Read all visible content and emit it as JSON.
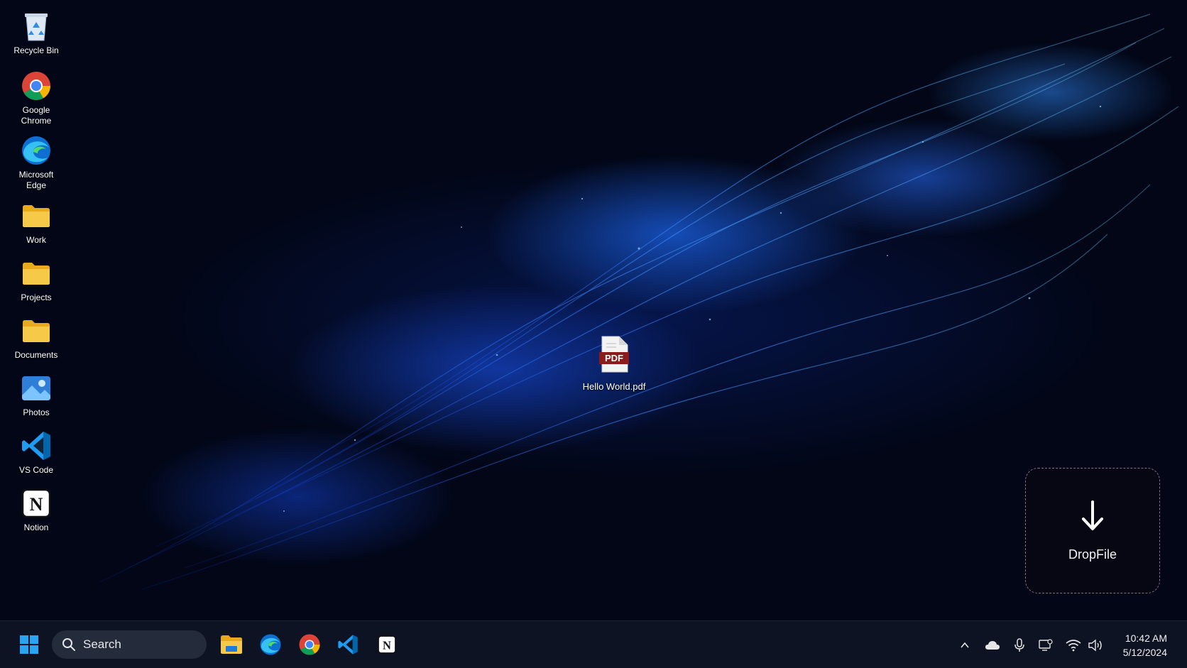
{
  "desktop": {
    "icons": [
      {
        "label": "Recycle Bin",
        "icon": "recycle-bin-icon"
      },
      {
        "label": "Google\nChrome",
        "icon": "chrome-icon"
      },
      {
        "label": "Microsoft\nEdge",
        "icon": "edge-icon"
      },
      {
        "label": "Work",
        "icon": "folder-icon"
      },
      {
        "label": "Projects",
        "icon": "folder-icon"
      },
      {
        "label": "Documents",
        "icon": "folder-icon"
      },
      {
        "label": "Photos",
        "icon": "photos-icon"
      },
      {
        "label": "VS Code",
        "icon": "vscode-icon"
      },
      {
        "label": "Notion",
        "icon": "notion-icon"
      }
    ],
    "file": {
      "label": "Hello World.pdf",
      "badge": "PDF"
    }
  },
  "dropfile": {
    "label": "DropFile"
  },
  "taskbar": {
    "search_placeholder": "Search",
    "pinned": [
      "file-explorer-icon",
      "edge-icon",
      "chrome-icon",
      "vscode-icon",
      "notion-icon"
    ],
    "tray": [
      "chevron-up-icon",
      "onedrive-icon",
      "microphone-icon",
      "display-icon",
      "wifi-icon",
      "volume-icon"
    ],
    "time": "10:42 AM",
    "date": "5/12/2024"
  },
  "colors": {
    "accent": "#1e6bff",
    "taskbar": "#0d1322",
    "folder": "#f7c948"
  }
}
